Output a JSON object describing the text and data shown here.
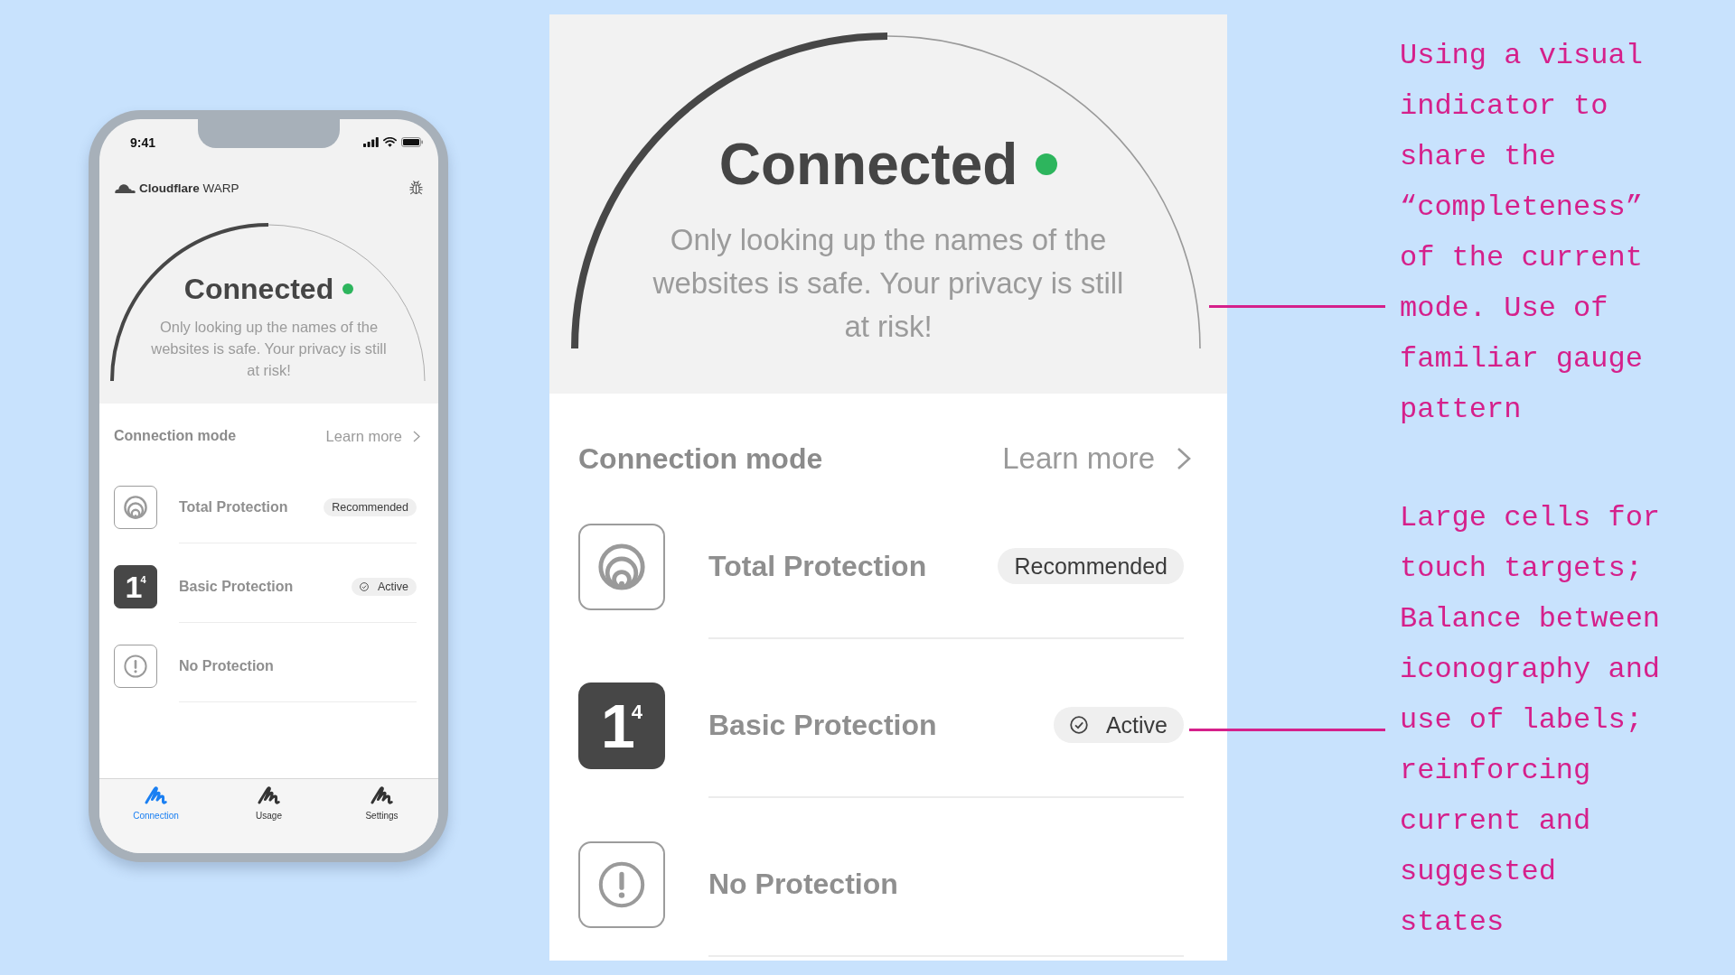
{
  "phone": {
    "status_bar": {
      "time": "9:41"
    },
    "header": {
      "brand": "**Cloudflare** WARP"
    },
    "gauge": {
      "title": "Connected",
      "connected": true,
      "level": 0.5,
      "description": "Only looking up the names of the websites is safe. Your privacy is still at risk!"
    },
    "connection_mode": {
      "title": "Connection mode",
      "link": "Learn more",
      "modes": [
        {
          "kind": "total",
          "title": "Total Protection",
          "selected": false,
          "badge": {
            "kind": "tag",
            "text": "Recommended"
          }
        },
        {
          "kind": "basic",
          "glyph": "1$^{4}$",
          "title": "Basic Protection",
          "selected": true,
          "badge": {
            "kind": "status",
            "text": "Active"
          }
        },
        {
          "kind": "none",
          "title": "No Protection",
          "selected": false
        }
      ]
    },
    "tab_bar": [
      {
        "label": "Connection",
        "selected": true
      },
      {
        "label": "Usage",
        "selected": false
      },
      {
        "label": "Settings",
        "selected": false
      }
    ]
  },
  "zoomed_view": {
    "gauge": {
      "title": "Connected",
      "connected": true,
      "level": 0.5,
      "description": "Only looking up the names of the websites is safe. Your privacy is still at risk!"
    },
    "connection_mode": {
      "title": "Connection mode",
      "link": "Learn more",
      "modes": [
        {
          "kind": "total",
          "title": "Total Protection",
          "selected": false,
          "badge": {
            "kind": "tag",
            "text": "Recommended"
          }
        },
        {
          "kind": "basic",
          "glyph": "1$^{4}$",
          "title": "Basic Protection",
          "selected": true,
          "badge": {
            "kind": "status",
            "text": "Active"
          }
        },
        {
          "kind": "none",
          "title": "No Protection",
          "selected": false
        }
      ]
    }
  },
  "annotations": [
    {
      "text": "Using a visual indicator to share the “completeness” of the current mode. Use of familiar gauge pattern"
    },
    {
      "text": "Large cells for touch targets; Balance between iconography and use of labels; reinforcing current and suggested states"
    }
  ]
}
